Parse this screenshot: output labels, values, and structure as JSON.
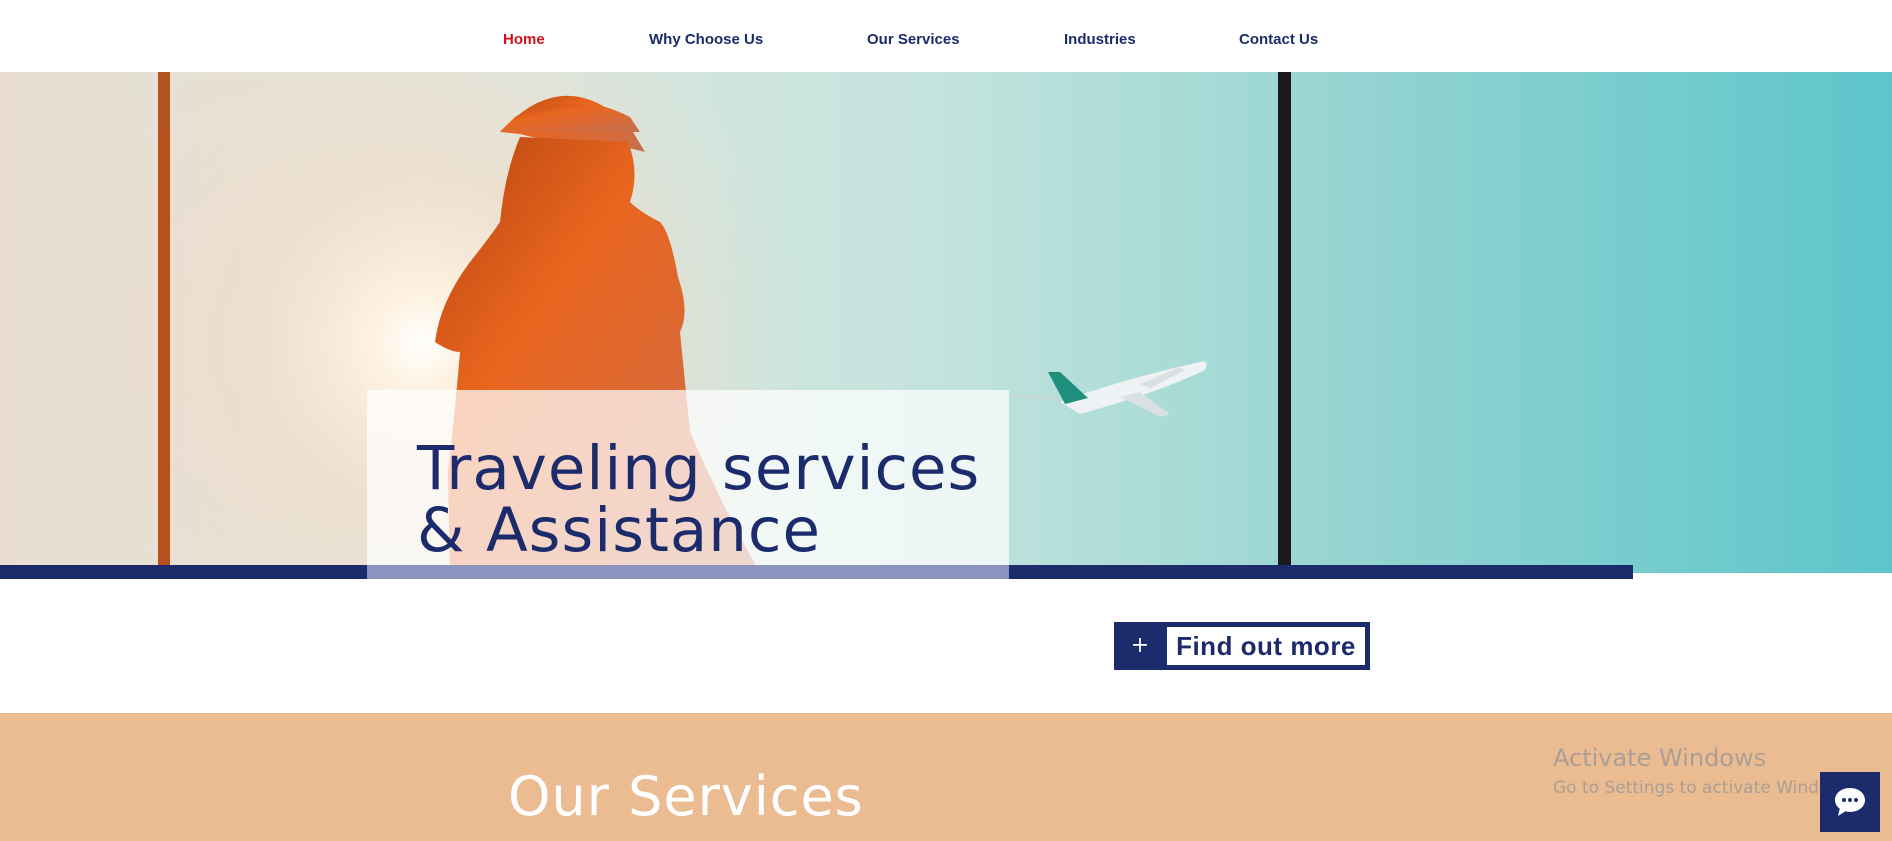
{
  "nav": {
    "items": [
      {
        "label": "Home",
        "active": true
      },
      {
        "label": "Why Choose Us",
        "active": false
      },
      {
        "label": "Our Services",
        "active": false
      },
      {
        "label": "Industries",
        "active": false
      },
      {
        "label": "Contact Us",
        "active": false
      }
    ]
  },
  "hero": {
    "title_line1": "Traveling services",
    "title_line2": "& Assistance",
    "image_subject": "woman silhouette with hat and airplane taking off at sunset"
  },
  "cta": {
    "plus": "+",
    "label": "Find out more"
  },
  "services": {
    "title": "Our Services"
  },
  "watermark": {
    "title": "Activate Windows",
    "subtitle": "Go to Settings to activate Windows."
  },
  "chat": {
    "icon": "chat-bubble-icon"
  },
  "colors": {
    "navy": "#1c2b6b",
    "active_nav": "#d0121d",
    "peach": "#ebbb92",
    "sky": "#5cc5cb"
  }
}
